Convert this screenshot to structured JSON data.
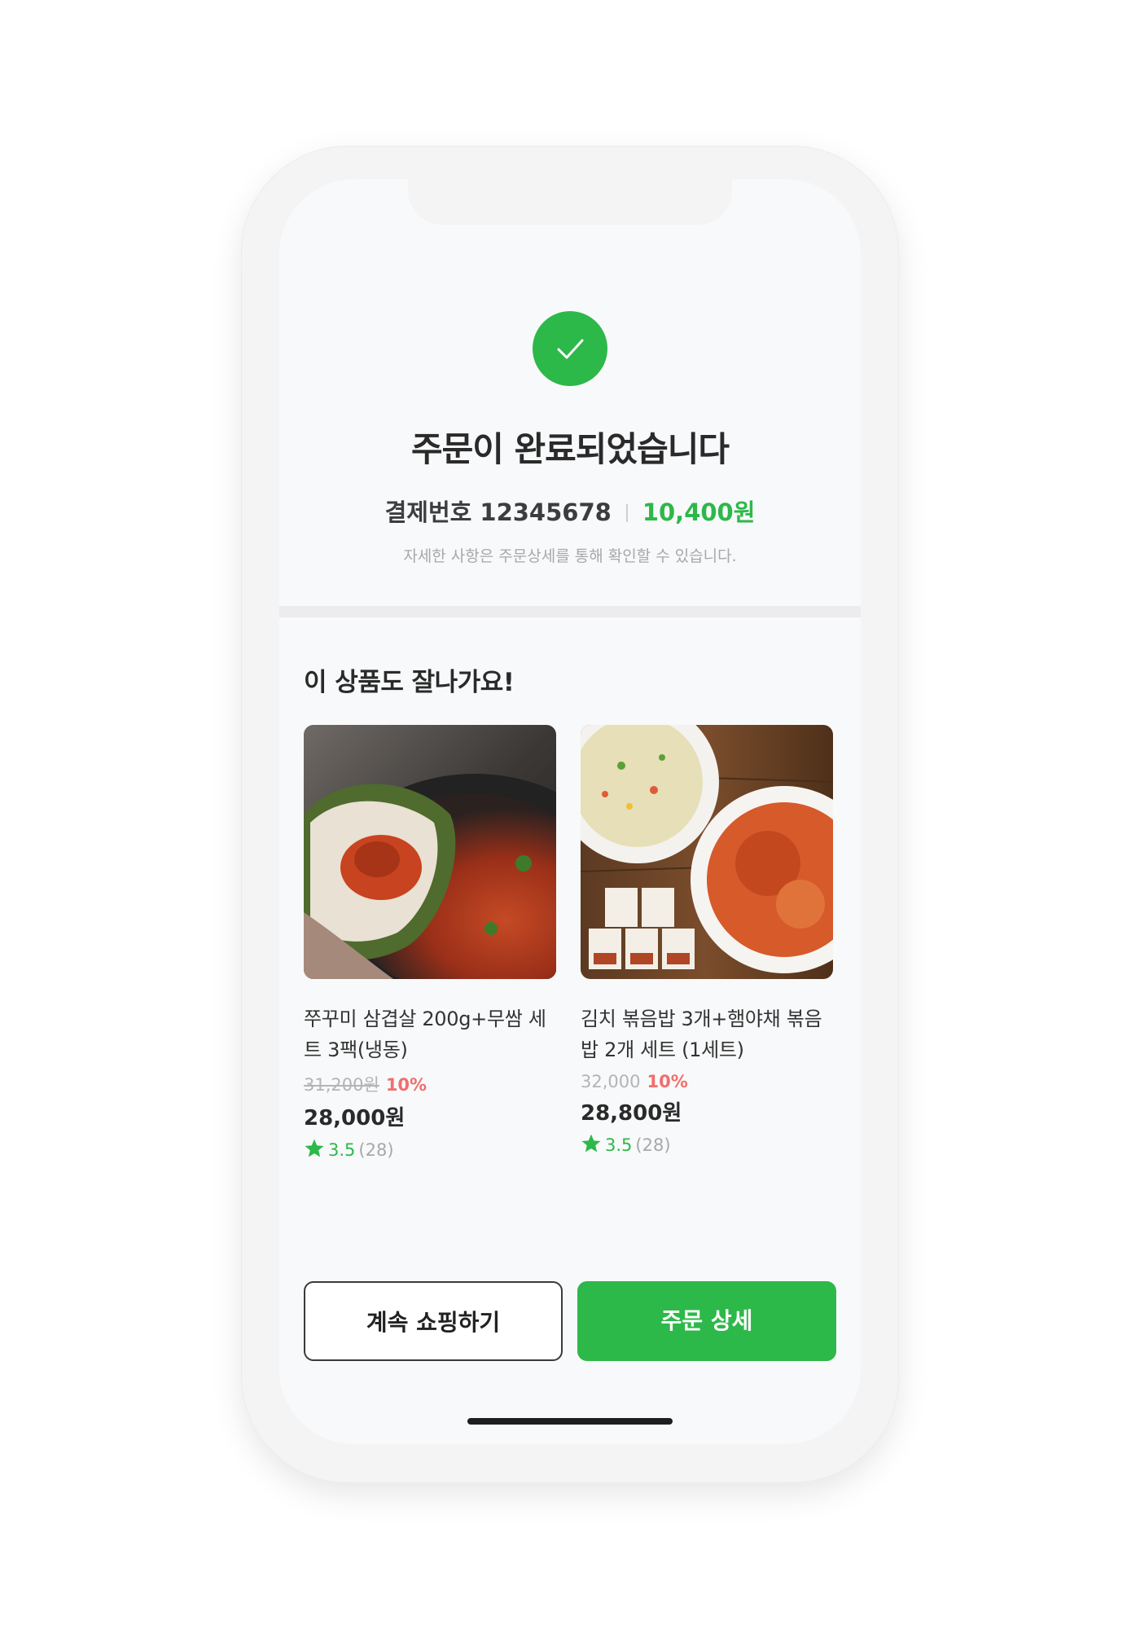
{
  "order": {
    "title": "주문이 완료되었습니다",
    "payment_label": "결제번호 12345678",
    "amount": "10,400원",
    "notice": "자세한 사항은 주문상세를 통해 확인할 수 있습니다."
  },
  "recommend": {
    "title": "이 상품도 잘나가요!",
    "products": [
      {
        "name": "쭈꾸미 삼겹살 200g+무쌈 세트 3팩(냉동)",
        "original_price": "31,200원",
        "discount": "10%",
        "price": "28,000원",
        "rating": "3.5",
        "review_count": "(28)"
      },
      {
        "name": "김치 볶음밥 3개+햄야채 볶음밥 2개 세트 (1세트)",
        "original_price": "32,000",
        "discount": "10%",
        "price": "28,800원",
        "rating": "3.5",
        "review_count": "(28)"
      }
    ]
  },
  "buttons": {
    "continue_shopping": "계속 쇼핑하기",
    "order_detail": "주문 상세"
  },
  "colors": {
    "accent": "#2db84a",
    "discount": "#f06e6e",
    "muted": "#a8a8a8"
  },
  "icons": {
    "success": "check-icon",
    "rating": "star-icon"
  }
}
